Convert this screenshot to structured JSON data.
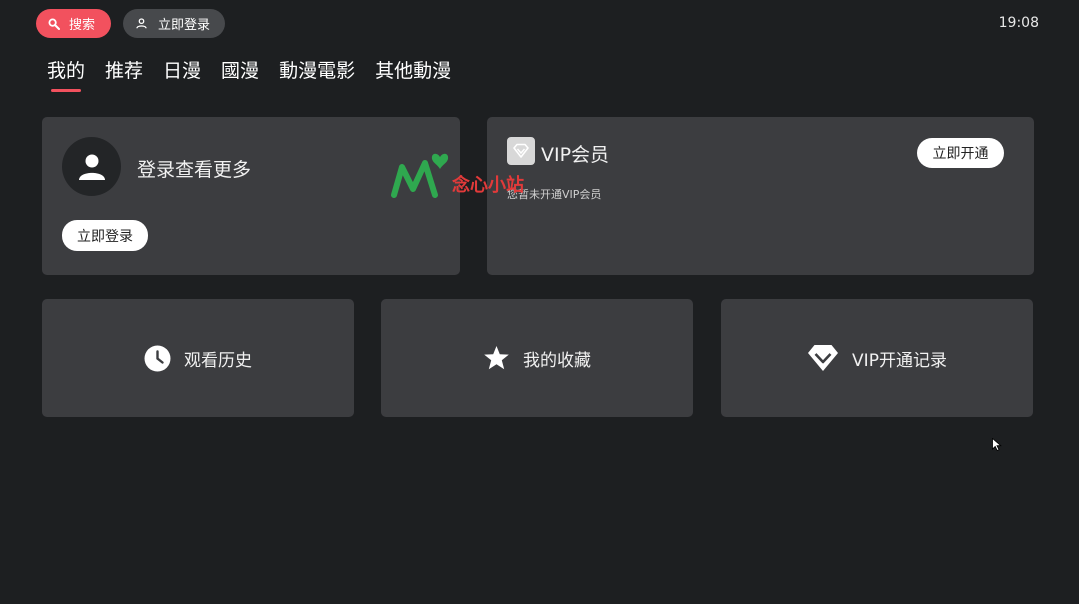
{
  "topbar": {
    "search_label": "搜索",
    "login_label": "立即登录",
    "clock": "19:08"
  },
  "tabs": [
    {
      "label": "我的",
      "active": true
    },
    {
      "label": "推荐"
    },
    {
      "label": "日漫"
    },
    {
      "label": "國漫"
    },
    {
      "label": "動漫電影"
    },
    {
      "label": "其他動漫"
    }
  ],
  "login_card": {
    "title": "登录查看更多",
    "button": "立即登录"
  },
  "vip_card": {
    "title": "VIP会员",
    "subtitle": "您暂未开通VIP会员",
    "button": "立即开通"
  },
  "tiles": [
    {
      "label": "观看历史",
      "icon": "clock-icon"
    },
    {
      "label": "我的收藏",
      "icon": "star-icon"
    },
    {
      "label": "VIP开通记录",
      "icon": "diamond-icon"
    }
  ],
  "watermark": {
    "text": "念心小站"
  },
  "colors": {
    "accent": "#f2515e",
    "background": "#1d1f21",
    "card": "#3c3d40"
  }
}
